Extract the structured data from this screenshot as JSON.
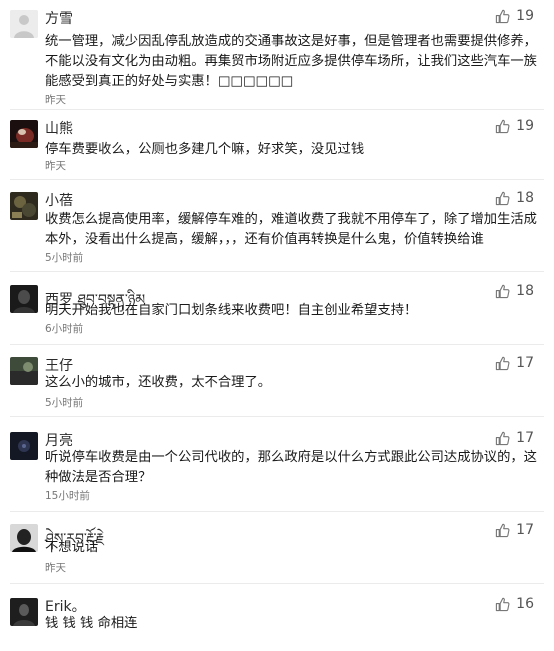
{
  "comments": [
    {
      "username": "方雪",
      "likes": "19",
      "text": "统一管理，减少因乱停乱放造成的交通事故这是好事，但是管理者也需要提供修养，不能以没有文化为由动粗。再集贸市场附近应多提供停车场所，让我们这些汽车一族能感受到真正的好处与实惠！□□□□□□",
      "time": "昨天"
    },
    {
      "username": "山熊",
      "likes": "19",
      "text": "停车费要收么，公厕也多建几个嘛，好求笑，没见过钱",
      "time": "昨天"
    },
    {
      "username": "小蓓",
      "likes": "18",
      "text": "收费怎么提高使用率，缓解停车难的，难道收费了我就不用停车了，除了增加生活成本外，没看出什么提高，缓解，，，还有价值再转换是什么鬼，价值转换给谁",
      "time": "5小时前"
    },
    {
      "username": "西罗 ཐུབ་བསྟན་ཉིམ",
      "likes": "18",
      "text": "明天开始我也在自家门口划条线来收费吧！自主创业希望支持！",
      "time": "6小时前"
    },
    {
      "username": "王仔",
      "likes": "17",
      "text": "这么小的城市，还收费，太不合理了。",
      "time": "5小时前"
    },
    {
      "username": "月亮",
      "likes": "17",
      "text": "听说停车收费是由一个公司代收的，那么政府是以什么方式跟此公司达成协议的，这种做法是否合理？",
      "time": "15小时前"
    },
    {
      "username": "ཤེས་རབ་རྡོ་རྗེ",
      "likes": "17",
      "text": "不想说话",
      "time": "昨天"
    },
    {
      "username": "Erik。",
      "likes": "16",
      "text": "钱 钱 钱 命相连",
      "time": ""
    }
  ]
}
